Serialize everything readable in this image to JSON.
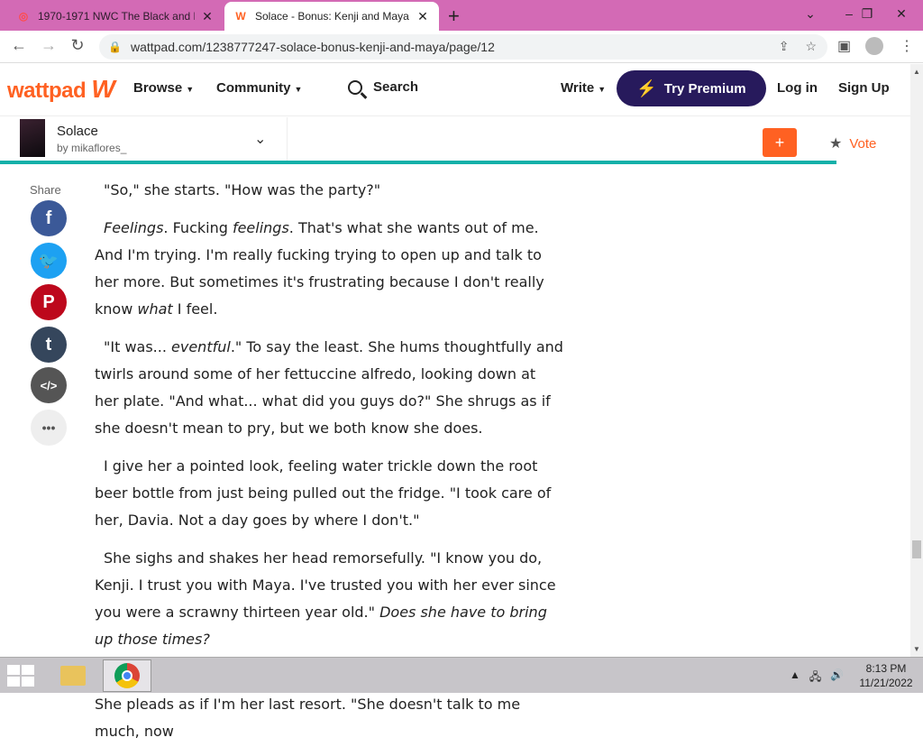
{
  "browser": {
    "tabs": [
      {
        "title": "1970-1971 NWC The Black and F",
        "active": false
      },
      {
        "title": "Solace - Bonus: Kenji and Maya -",
        "active": true
      }
    ],
    "url": "wattpad.com/1238777247-solace-bonus-kenji-and-maya/page/12",
    "window_controls": [
      "⌄",
      "–",
      "❐",
      "✕"
    ]
  },
  "header": {
    "logo": "wattpad",
    "browse": "Browse",
    "community": "Community",
    "search": "Search",
    "write": "Write",
    "premium": "Try Premium",
    "login": "Log in",
    "signup": "Sign Up"
  },
  "story": {
    "title": "Solace",
    "author": "by mikaflores_",
    "add_label": "+",
    "vote_label": "Vote",
    "reading_progress": 0.91
  },
  "share": {
    "label": "Share",
    "buttons": [
      {
        "name": "facebook",
        "glyph": "f",
        "color": "#3b5998"
      },
      {
        "name": "twitter",
        "glyph": "🐦",
        "color": "#1da1f2"
      },
      {
        "name": "pinterest",
        "glyph": "P",
        "color": "#bd081c"
      },
      {
        "name": "tumblr",
        "glyph": "t",
        "color": "#35465c"
      },
      {
        "name": "embed",
        "glyph": "</>",
        "color": "#555555"
      },
      {
        "name": "more",
        "glyph": "•••",
        "color": "#eeeeee"
      }
    ]
  },
  "paragraphs": [
    [
      {
        "t": "\"So,\" she starts. \"How was the party?\""
      }
    ],
    [
      {
        "t": "Feelings",
        "i": true
      },
      {
        "t": ". Fucking "
      },
      {
        "t": "feelings",
        "i": true
      },
      {
        "t": ". That's what she wants out of me. And I'm trying. I'm really fucking trying to open up and talk to her more. But sometimes it's frustrating because I don't really know "
      },
      {
        "t": "what",
        "i": true
      },
      {
        "t": " I feel."
      }
    ],
    [
      {
        "t": "\"It was... "
      },
      {
        "t": "eventful",
        "i": true
      },
      {
        "t": ".\" To say the least. She hums thoughtfully and twirls around some of her fettuccine alfredo, looking down at her plate. \"And what... what did you guys do?\" She shrugs as if she doesn't mean to pry, but we both know she does."
      }
    ],
    [
      {
        "t": "I give her a pointed look, feeling water trickle down the root beer bottle from just being pulled out the fridge. \"I took care of her, Davia. Not a day goes by where I don't.\""
      }
    ],
    [
      {
        "t": "She sighs and shakes her head remorsefully. \"I know you do, Kenji. I trust you with Maya. I've trusted you with her ever since you were a scrawny thirteen year old.\" "
      },
      {
        "t": "Does she have to bring up those times?",
        "i": true
      }
    ],
    [
      {
        "t": "\"I just... I just wanna know what's going on with my daughter.\" She pleads as if I'm her last resort. \"She doesn't talk to me much, now"
      }
    ]
  ],
  "taskbar": {
    "time": "8:13 PM",
    "date": "11/21/2022"
  }
}
